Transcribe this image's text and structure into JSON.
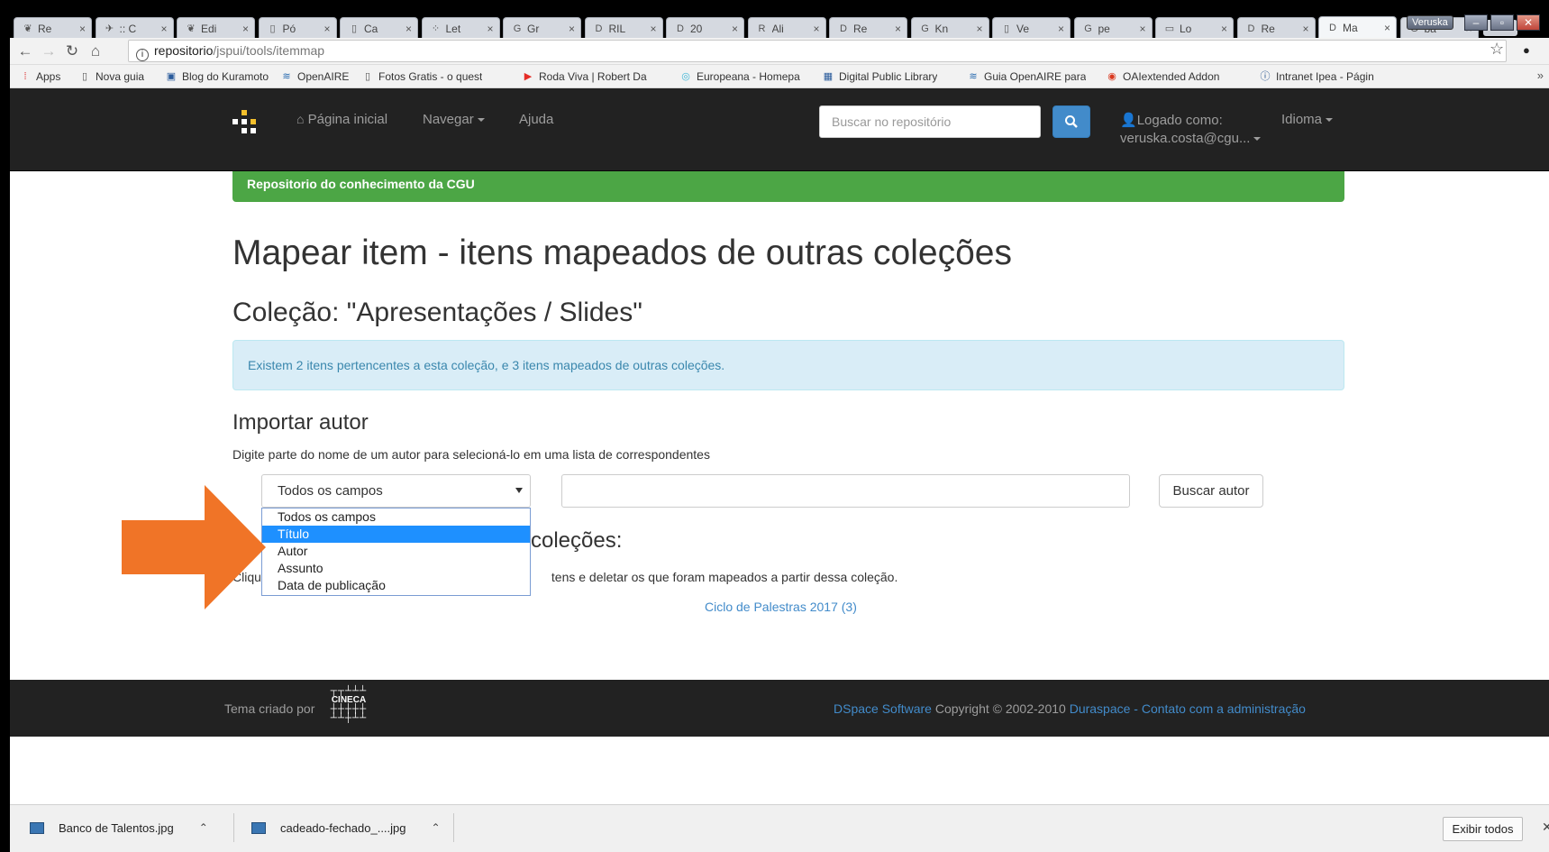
{
  "browser": {
    "tabs": [
      {
        "icon": "leaf",
        "label": "Re"
      },
      {
        "icon": "plane",
        "label": ":: C"
      },
      {
        "icon": "leaf",
        "label": "Edi"
      },
      {
        "icon": "doc",
        "label": "Pó"
      },
      {
        "icon": "doc",
        "label": "Ca"
      },
      {
        "icon": "dots",
        "label": "Let"
      },
      {
        "icon": "G",
        "label": "Gr"
      },
      {
        "icon": "D",
        "label": "RIL"
      },
      {
        "icon": "D",
        "label": "20"
      },
      {
        "icon": "RSP",
        "label": "Ali"
      },
      {
        "icon": "D",
        "label": "Re"
      },
      {
        "icon": "G",
        "label": "Kn"
      },
      {
        "icon": "doc",
        "label": "Ve"
      },
      {
        "icon": "G",
        "label": "pe"
      },
      {
        "icon": "card",
        "label": "Lo"
      },
      {
        "icon": "D",
        "label": "Re"
      },
      {
        "icon": "D",
        "label": "Ma"
      },
      {
        "icon": "G",
        "label": "ba"
      }
    ],
    "active_tab_index": 16,
    "profile_name": "Veruska",
    "url_host": "repositorio",
    "url_path": "/jspui/tools/itemmap",
    "bookmarks": [
      {
        "icon": "apps",
        "label": "Apps"
      },
      {
        "icon": "doc",
        "label": "Nova guia"
      },
      {
        "icon": "img",
        "label": "Blog do Kuramoto"
      },
      {
        "icon": "openaire",
        "label": "OpenAIRE"
      },
      {
        "icon": "doc",
        "label": "Fotos Gratis - o quest"
      },
      {
        "icon": "yt",
        "label": "Roda Viva | Robert Da"
      },
      {
        "icon": "europeana",
        "label": "Europeana - Homepa"
      },
      {
        "icon": "dpla",
        "label": "Digital Public Library"
      },
      {
        "icon": "openaire",
        "label": "Guia OpenAIRE para"
      },
      {
        "icon": "oa",
        "label": "OAIextended Addon"
      },
      {
        "icon": "info",
        "label": "Intranet Ipea - Página"
      }
    ],
    "bookmarks_more": "»"
  },
  "navbar": {
    "home": "Página inicial",
    "browse": "Navegar",
    "help": "Ajuda",
    "search_placeholder": "Buscar no repositório",
    "login_line1": "Logado como:",
    "login_line2": "veruska.costa@cgu...",
    "language": "Idioma"
  },
  "banner": "Repositorio do conhecimento da CGU",
  "main": {
    "title": "Mapear item - itens mapeados de outras coleções",
    "collection": "Coleção: \"Apresentações / Slides\"",
    "alert": "Existem 2 itens pertencentes a esta coleção, e 3 itens mapeados de outras coleções.",
    "import_heading": "Importar autor",
    "import_help": "Digite parte do nome de um autor para selecioná-lo em uma lista de correspondentes",
    "field_select": {
      "selected": "Todos os campos",
      "options": [
        "Todos os campos",
        "Título",
        "Autor",
        "Assunto",
        "Data de publicação"
      ],
      "highlighted_index": 1
    },
    "author_value": "",
    "author_button": "Buscar autor",
    "mapped_heading_visible": "coleções:",
    "mapped_help_prefix": "Cliqu",
    "mapped_help_visible": "tens e deletar os que foram mapeados a partir dessa coleção.",
    "mapped_collection_link": "Ciclo de Palestras 2017 (3)"
  },
  "footer": {
    "theme_by": "Tema criado por",
    "cineca_text": "CINECA",
    "dspace": "DSpace Software",
    "copyright": "Copyright © 2002-2010",
    "duraspace": "Duraspace",
    "separator": "-",
    "contact": "Contato com a administração"
  },
  "downloads": {
    "items": [
      "Banco de Talentos.jpg",
      "cadeado-fechado_....jpg"
    ],
    "show_all": "Exibir todos"
  },
  "colors": {
    "navbar_bg": "#222222",
    "banner_green": "#4ca645",
    "alert_bg": "#d9edf7",
    "alert_text": "#3a87ad",
    "link_blue": "#428bca",
    "dropdown_highlight": "#1e90ff",
    "arrow_orange": "#f07427"
  }
}
